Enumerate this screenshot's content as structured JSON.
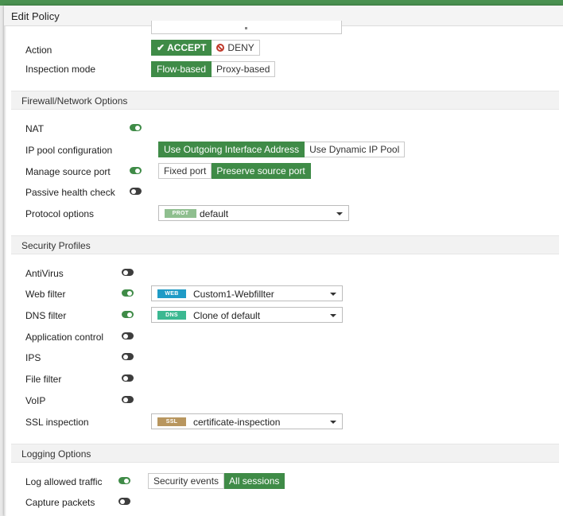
{
  "dialog": {
    "title": "Edit Policy"
  },
  "policy": {
    "action": {
      "label": "Action",
      "accept": "ACCEPT",
      "deny": "DENY",
      "selected": "accept"
    },
    "inspection_mode": {
      "label": "Inspection mode",
      "flow": "Flow-based",
      "proxy": "Proxy-based",
      "selected": "flow"
    }
  },
  "firewall": {
    "header": "Firewall/Network Options",
    "nat": {
      "label": "NAT",
      "enabled": true
    },
    "ip_pool": {
      "label": "IP pool configuration",
      "outgoing": "Use Outgoing Interface Address",
      "dynamic": "Use Dynamic IP Pool",
      "selected": "outgoing"
    },
    "source_port": {
      "label": "Manage source port",
      "enabled": true,
      "fixed": "Fixed port",
      "preserve": "Preserve source port",
      "selected": "preserve"
    },
    "passive_health": {
      "label": "Passive health check",
      "enabled": false
    },
    "protocol_options": {
      "label": "Protocol options",
      "tag": "PROT",
      "value": "default",
      "tag_color": "#8fbf8f"
    }
  },
  "security": {
    "header": "Security Profiles",
    "antivirus": {
      "label": "AntiVirus",
      "enabled": false
    },
    "web_filter": {
      "label": "Web filter",
      "enabled": true,
      "tag": "WEB",
      "value": "Custom1-Webfillter",
      "tag_color": "#1f9bc6"
    },
    "dns_filter": {
      "label": "DNS filter",
      "enabled": true,
      "tag": "DNS",
      "value": "Clone of default",
      "tag_color": "#3bb891"
    },
    "app_control": {
      "label": "Application control",
      "enabled": false
    },
    "ips": {
      "label": "IPS",
      "enabled": false
    },
    "file_filter": {
      "label": "File filter",
      "enabled": false
    },
    "voip": {
      "label": "VoIP",
      "enabled": false
    },
    "ssl": {
      "label": "SSL inspection",
      "tag": "SSL",
      "value": "certificate-inspection",
      "tag_color": "#b8965f"
    }
  },
  "logging": {
    "header": "Logging Options",
    "log_allowed": {
      "label": "Log allowed traffic",
      "enabled": true,
      "security": "Security events",
      "all": "All sessions",
      "selected": "all"
    },
    "capture": {
      "label": "Capture packets",
      "enabled": false
    }
  },
  "colors": {
    "accent": "#3f8b47",
    "toggle_off": "#3d3d3d",
    "deny": "#c0392b"
  }
}
